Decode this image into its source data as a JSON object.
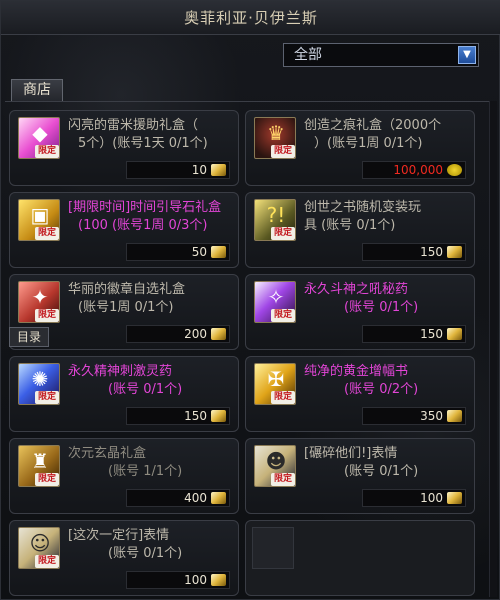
{
  "window": {
    "title": "奥菲利亚·贝伊兰斯"
  },
  "filter": {
    "selected": "全部"
  },
  "tabs": {
    "shop": "商店",
    "catalog": "目录"
  },
  "items": [
    {
      "line1": "闪亮的雷米援助礼盒（",
      "line2": "5个）(账号1天 0/1个)",
      "price": "10",
      "badge": "限定",
      "style": "normal"
    },
    {
      "line1": "创造之痕礼盒（2000个",
      "line2": "）(账号1周 0/1个)",
      "price": "100,000",
      "badge": "限定",
      "style": "normal",
      "price_color": "#f02a20"
    },
    {
      "line1": "[期限时间]时间引导石礼盒",
      "line2": "(100 (账号1周 0/3个)",
      "price": "50",
      "badge": "限定",
      "style": "pink"
    },
    {
      "line1": "创世之书随机变装玩",
      "line2": "具     (账号 0/1个)",
      "price": "150",
      "badge": "限定",
      "style": "normal"
    },
    {
      "line1": "华丽的徽章自选礼盒",
      "line2": "(账号1周 0/1个)",
      "price": "200",
      "badge": "限定",
      "style": "normal"
    },
    {
      "line1": "永久斗神之吼秘药",
      "line2": "(账号 0/1个)",
      "price": "150",
      "badge": "限定",
      "style": "pink"
    },
    {
      "line1": "永久精神刺激灵药",
      "line2": "(账号 0/1个)",
      "price": "150",
      "badge": "限定",
      "style": "pink"
    },
    {
      "line1": "纯净的黄金增幅书",
      "line2": "(账号 0/2个)",
      "price": "350",
      "badge": "限定",
      "style": "pink"
    },
    {
      "line1": "次元玄晶礼盒",
      "line2": "(账号 1/1个)",
      "price": "400",
      "badge": "限定",
      "style": "dim"
    },
    {
      "line1": "[碾碎他们!]表情",
      "line2": "(账号 0/1个)",
      "price": "100",
      "badge": "限定",
      "style": "normal"
    },
    {
      "line1": "[这次一定行]表情",
      "line2": "(账号 0/1个)",
      "price": "100",
      "badge": "限定",
      "style": "normal"
    }
  ],
  "colors": {
    "pink_text": "#e245d6",
    "red_price": "#f02a20"
  },
  "icons": [
    "pink-gift-icon",
    "crown-gift-icon",
    "gold-box-icon",
    "scroll-book-icon",
    "badge-box-icon",
    "purple-potion-icon",
    "blue-potion-icon",
    "amber-book-icon",
    "bag-box-icon",
    "emote-icon",
    "emote-icon"
  ]
}
